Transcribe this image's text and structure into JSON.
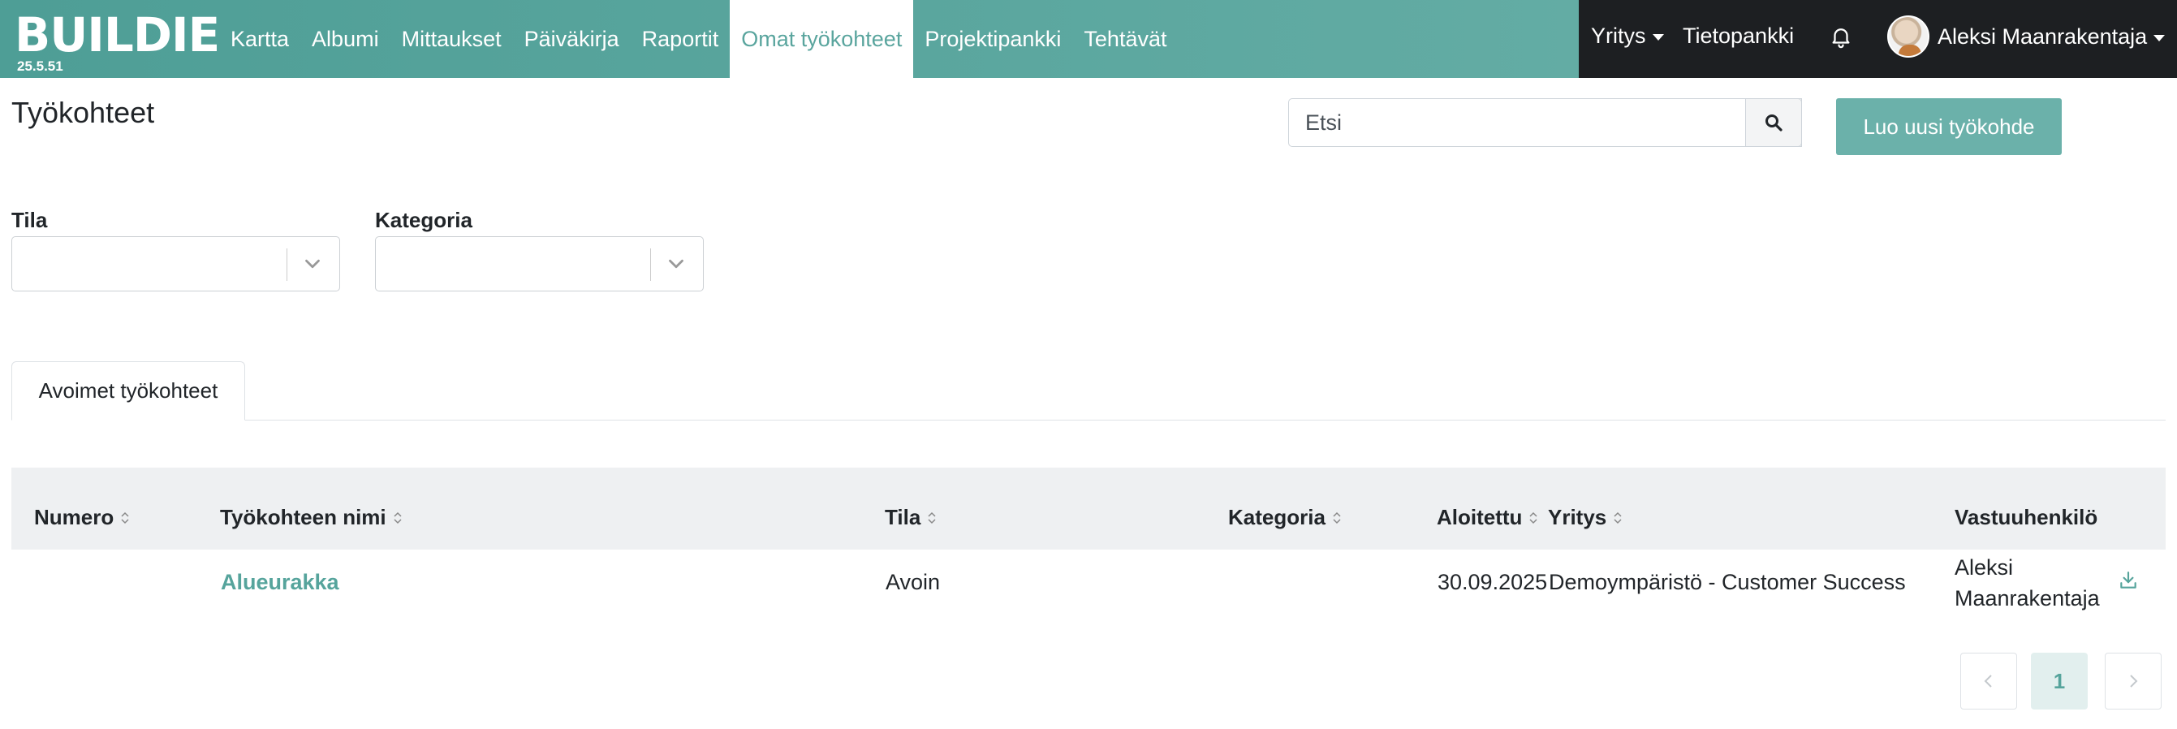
{
  "app": {
    "logo_text": "BUILDIE",
    "version": "25.5.51"
  },
  "nav": {
    "items": [
      {
        "label": "Kartta"
      },
      {
        "label": "Albumi"
      },
      {
        "label": "Mittaukset"
      },
      {
        "label": "Päiväkirja"
      },
      {
        "label": "Raportit"
      },
      {
        "label": "Omat työkohteet",
        "active": true
      },
      {
        "label": "Projektipankki"
      },
      {
        "label": "Tehtävät"
      }
    ],
    "company_label": "Yritys",
    "knowledge_label": "Tietopankki",
    "user_name": "Aleksi Maanrakentaja"
  },
  "page": {
    "title": "Työkohteet",
    "search_placeholder": "Etsi",
    "create_button_label": "Luo uusi työkohde"
  },
  "filters": {
    "status_label": "Tila",
    "category_label": "Kategoria"
  },
  "tabs": [
    {
      "label": "Avoimet työkohteet",
      "active": true
    }
  ],
  "table": {
    "columns": [
      "Numero",
      "Työkohteen nimi",
      "Tila",
      "Kategoria",
      "Aloitettu",
      "Yritys",
      "Vastuuhenkilö"
    ],
    "rows": [
      {
        "number": "",
        "name": "Alueurakka",
        "status": "Avoin",
        "category": "",
        "started": "30.09.2025",
        "company": "Demoympäristö - Customer Success",
        "person": "Aleksi Maanrakentaja"
      }
    ]
  },
  "pagination": {
    "current_page": "1"
  },
  "colors": {
    "accent": "#5aa59e",
    "nav_dark": "#1d1f22",
    "button": "#6bb1aa"
  }
}
